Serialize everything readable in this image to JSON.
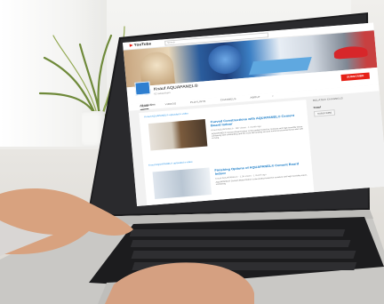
{
  "youtube": {
    "logo": "YouTube",
    "search_placeholder": "Search",
    "channel_name": "Knauf AQUAPANEL®",
    "subscribers": "62 subscribers",
    "subscribe_label": "SUBSCRIBE",
    "tabs": [
      "HOME",
      "VIDEOS",
      "PLAYLISTS",
      "CHANNELS",
      "ABOUT"
    ],
    "activity_label": "All activities",
    "posts": [
      {
        "label": "Knauf AQUAPANEL® uploaded a video",
        "title": "Curved Constructions with AQUAPANEL® Cement Board Indoor",
        "meta": "Knauf AQUAPANEL® · 987 views · 1 month ago",
        "desc": "AQUAPANEL® Cement Board Indoor is the perfect board for moisture and high humidity areas, combining with outstanding and the most demanding wet and humid environments but also with curving"
      },
      {
        "label": "Knauf AQUAPANEL® uploaded a video",
        "title": "Finishing Options of AQUAPANEL® Cement Board Indoor",
        "meta": "Knauf AQUAPANEL® · 1.3K views · 1 month ago",
        "desc": "AQUAPANEL® Cement Board Indoor is the perfect board for moisture and high humidity areas, combining"
      }
    ],
    "related_heading": "RELATED CHANNELS",
    "related_channel": "Knauf",
    "related_subscribe": "SUBSCRIBE"
  }
}
